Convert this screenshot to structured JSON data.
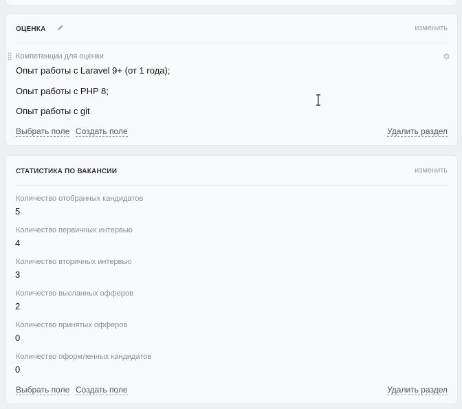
{
  "evaluation": {
    "title": "ОЦЕНКА",
    "edit_label": "изменить",
    "field_label": "Компетенции для оценки",
    "competencies": [
      "Опыт работы с Laravel 9+ (от 1 года);",
      "Опыт работы с PHP 8;",
      "Опыт работы с git"
    ],
    "select_field": "Выбрать поле",
    "create_field": "Создать поле",
    "delete_section": "Удалить раздел"
  },
  "statistics": {
    "title": "СТАТИСТИКА ПО ВАКАНСИИ",
    "edit_label": "изменить",
    "items": [
      {
        "label": "Количество отобранных кандидатов",
        "value": "5"
      },
      {
        "label": "Количество первичных интервью",
        "value": "4"
      },
      {
        "label": "Количество вторичных интервью",
        "value": "3"
      },
      {
        "label": "Количество высланных офферов",
        "value": "2"
      },
      {
        "label": "Количество принятых офферов",
        "value": "0"
      },
      {
        "label": "Количество оформленных кандидатов",
        "value": "0"
      }
    ],
    "select_field": "Выбрать поле",
    "create_field": "Создать поле",
    "delete_section": "Удалить раздел"
  },
  "colors": {
    "background": "#eef0f2",
    "card": "#f9fafb",
    "muted_text": "#8a8f94",
    "link_text": "#555555"
  },
  "icons": [
    "pencil-icon",
    "drag-handle-icon",
    "gear-icon",
    "text-cursor-icon"
  ]
}
